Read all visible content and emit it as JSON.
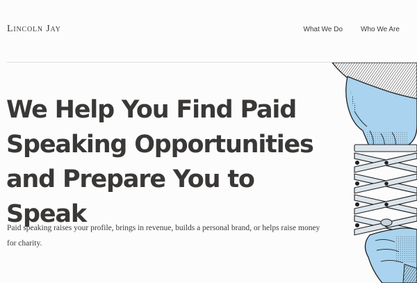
{
  "header": {
    "brand": "Lincoln Jay",
    "nav": [
      {
        "label": "What We Do"
      },
      {
        "label": "Who We Are"
      }
    ]
  },
  "hero": {
    "headline": "We Help You Find Paid Speaking Opportunities and Prepare You to Speak",
    "subtext": "Paid speaking raises your profile, brings in revenue, builds a personal brand, or helps raise money for charity."
  },
  "illustration": {
    "icon": "hands-scissor-lift-illustration",
    "colors": {
      "hand": "#a9d3ee",
      "ink": "#1f1f22",
      "metal": "#dde6ec"
    }
  }
}
